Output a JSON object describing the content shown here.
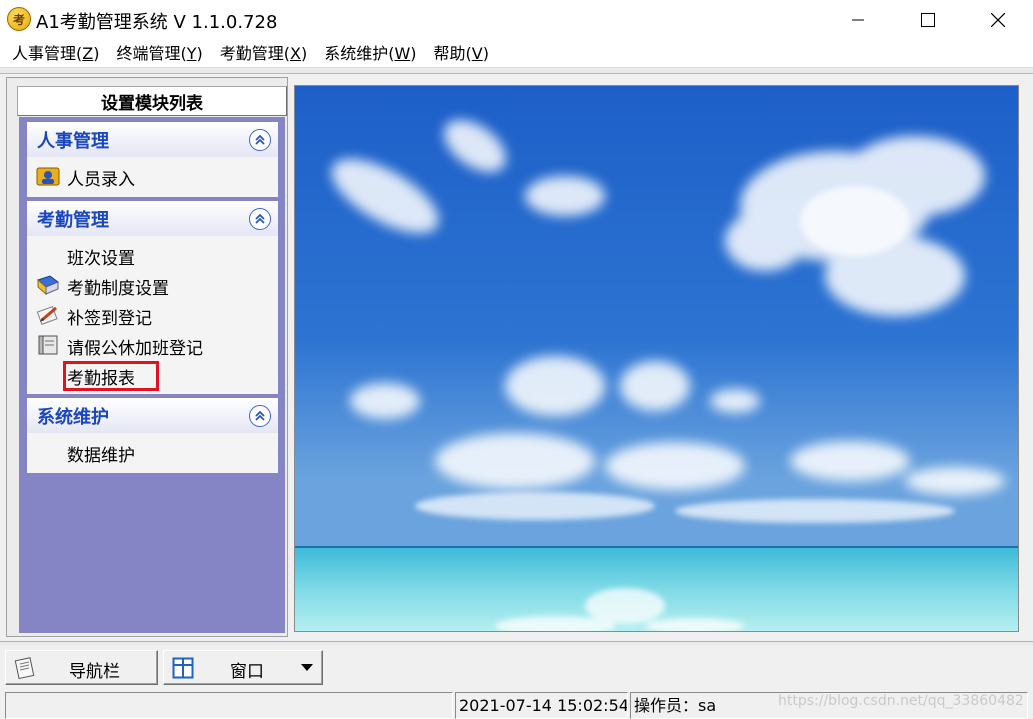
{
  "window": {
    "title": "A1考勤管理系统 V 1.1.0.728",
    "app_icon_text": "考",
    "controls": {
      "minimize": "minimize-icon",
      "maximize": "maximize-icon",
      "close": "close-icon"
    }
  },
  "menubar": {
    "items": [
      {
        "label": "人事管理(",
        "hotkey": "Z",
        "close": ")"
      },
      {
        "label": "终端管理(",
        "hotkey": "Y",
        "close": ")"
      },
      {
        "label": "考勤管理(",
        "hotkey": "X",
        "close": ")"
      },
      {
        "label": "系统维护(",
        "hotkey": "W",
        "close": ")"
      },
      {
        "label": "帮助(",
        "hotkey": "V",
        "close": ")"
      }
    ]
  },
  "sidebar": {
    "header": "设置模块列表",
    "groups": [
      {
        "title": "人事管理",
        "items": [
          {
            "label": "人员录入",
            "icon": "person-card-icon"
          }
        ]
      },
      {
        "title": "考勤管理",
        "items": [
          {
            "label": "班次设置",
            "icon": ""
          },
          {
            "label": "考勤制度设置",
            "icon": "rules-book-icon"
          },
          {
            "label": "补签到登记",
            "icon": "pencil-note-icon"
          },
          {
            "label": "请假公休加班登记",
            "icon": "ledger-icon"
          },
          {
            "label": "考勤报表",
            "icon": "",
            "highlighted": true
          }
        ]
      },
      {
        "title": "系统维护",
        "items": [
          {
            "label": "数据维护",
            "icon": ""
          }
        ]
      }
    ]
  },
  "toolbar": {
    "nav_button": "导航栏",
    "window_select": "窗口"
  },
  "statusbar": {
    "datetime": "2021-07-14 15:02:54",
    "operator": "操作员：sa",
    "watermark": "https://blog.csdn.net/qq_33860482"
  },
  "colors": {
    "accent_blue": "#1a47c0",
    "nav_background": "#8585c6",
    "highlight_red": "#e0141e"
  }
}
